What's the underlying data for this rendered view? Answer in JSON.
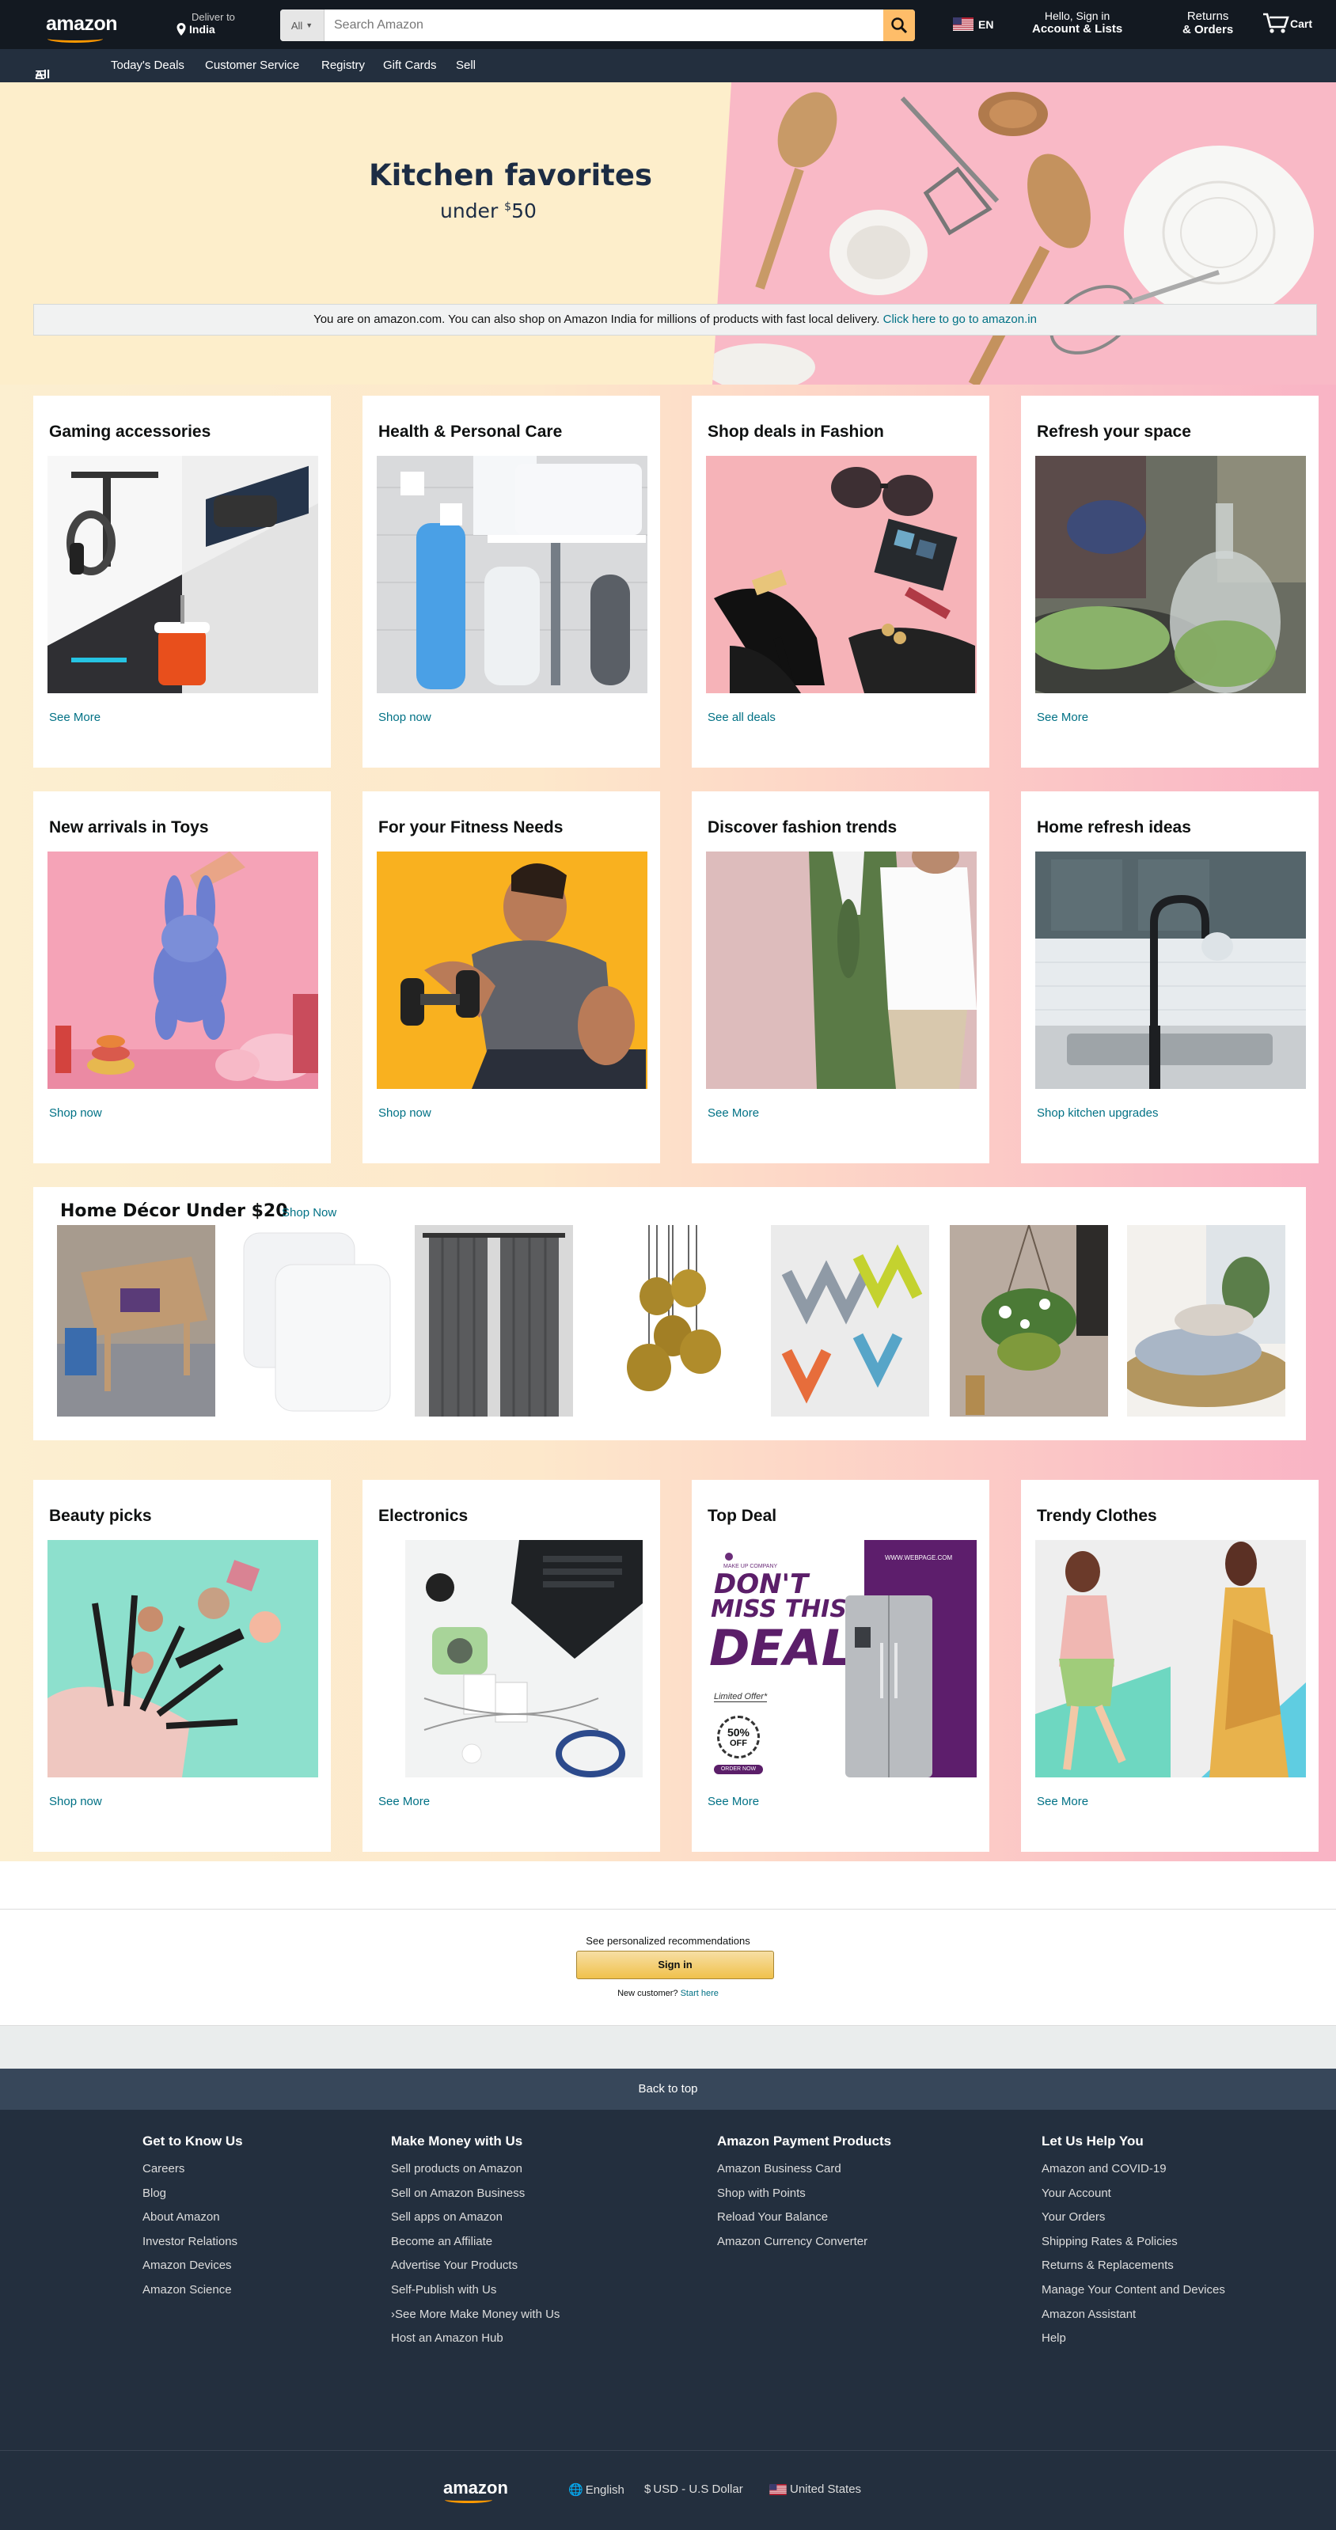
{
  "header": {
    "logo": "amazon",
    "deliver_label": "Deliver to",
    "deliver_location": "India",
    "search_category": "All",
    "search_placeholder": "Search Amazon",
    "language": "EN",
    "account_greeting": "Hello, Sign in",
    "account_label": "Account & Lists",
    "returns_line1": "Returns",
    "returns_line2": "& Orders",
    "cart_label": "Cart"
  },
  "subnav": {
    "all": "All",
    "items": [
      "Today's Deals",
      "Customer Service",
      "Registry",
      "Gift Cards",
      "Sell"
    ]
  },
  "hero": {
    "title": "Kitchen favorites",
    "subtitle_prefix": "under ",
    "subtitle_currency": "$",
    "subtitle_amount": "50"
  },
  "notice": {
    "text": "You are on amazon.com. You can also shop on Amazon India for millions of products with fast local delivery. ",
    "link": "Click here to go to amazon.in"
  },
  "cards": [
    {
      "title": "Gaming accessories",
      "link": "See More"
    },
    {
      "title": "Health & Personal Care",
      "link": "Shop now"
    },
    {
      "title": "Shop deals in Fashion",
      "link": "See all deals"
    },
    {
      "title": "Refresh your space",
      "link": "See More"
    },
    {
      "title": "New arrivals in Toys",
      "link": "Shop now"
    },
    {
      "title": "For your Fitness Needs",
      "link": "Shop now"
    },
    {
      "title": "Discover fashion trends",
      "link": "See More"
    },
    {
      "title": "Home refresh ideas",
      "link": "Shop kitchen upgrades"
    },
    {
      "title": "Beauty picks",
      "link": "Shop now"
    },
    {
      "title": "Electronics",
      "link": "See More"
    },
    {
      "title": "Top Deal",
      "link": "See More"
    },
    {
      "title": "Trendy Clothes",
      "link": "See More"
    }
  ],
  "top_deal_ad": {
    "brand": "MAKE UP COMPANY",
    "line1": "DON'T",
    "line2": "MISS THIS",
    "line3": "DEAL",
    "limited": "Limited Offer*",
    "badge_pct": "50%",
    "badge_off": "OFF",
    "order": "ORDER NOW",
    "website": "WWW.WEBPAGE.COM"
  },
  "decor": {
    "title": "Home Décor Under $20",
    "shop_now": "Shop Now"
  },
  "signin": {
    "prompt": "See personalized recommendations",
    "button": "Sign in",
    "new_customer": "New customer?",
    "start_here": "Start here"
  },
  "footer": {
    "back_to_top": "Back to top",
    "columns": [
      {
        "heading": "Get to Know Us",
        "items": [
          "Careers",
          "Blog",
          "About Amazon",
          "Investor Relations",
          "Amazon Devices",
          "Amazon Science"
        ]
      },
      {
        "heading": "Make Money with Us",
        "items": [
          "Sell products on Amazon",
          "Sell on Amazon Business",
          "Sell apps on Amazon",
          "Become an Affiliate",
          "Advertise Your Products",
          "Self-Publish with Us",
          "›See More Make Money with Us",
          "Host an Amazon Hub"
        ]
      },
      {
        "heading": "Amazon Payment Products",
        "items": [
          "Amazon Business Card",
          "Shop with Points",
          "Reload Your Balance",
          "Amazon Currency Converter"
        ]
      },
      {
        "heading": "Let Us Help You",
        "items": [
          "Amazon and COVID-19",
          "Your Account",
          "Your Orders",
          "Shipping Rates & Policies",
          "Returns & Replacements",
          "Manage Your Content and Devices",
          "Amazon Assistant",
          "Help"
        ]
      }
    ],
    "bottom_logo": "amazon",
    "language": "English",
    "currency_symbol": "$",
    "currency": "USD - U.S Dollar",
    "country": "United States"
  },
  "colors": {
    "nav_dark": "#131921",
    "nav_sub": "#232f3e",
    "accent": "#febd69",
    "link": "#007185",
    "hero_left": "#fdeecb",
    "hero_right": "#f9b9c6"
  }
}
